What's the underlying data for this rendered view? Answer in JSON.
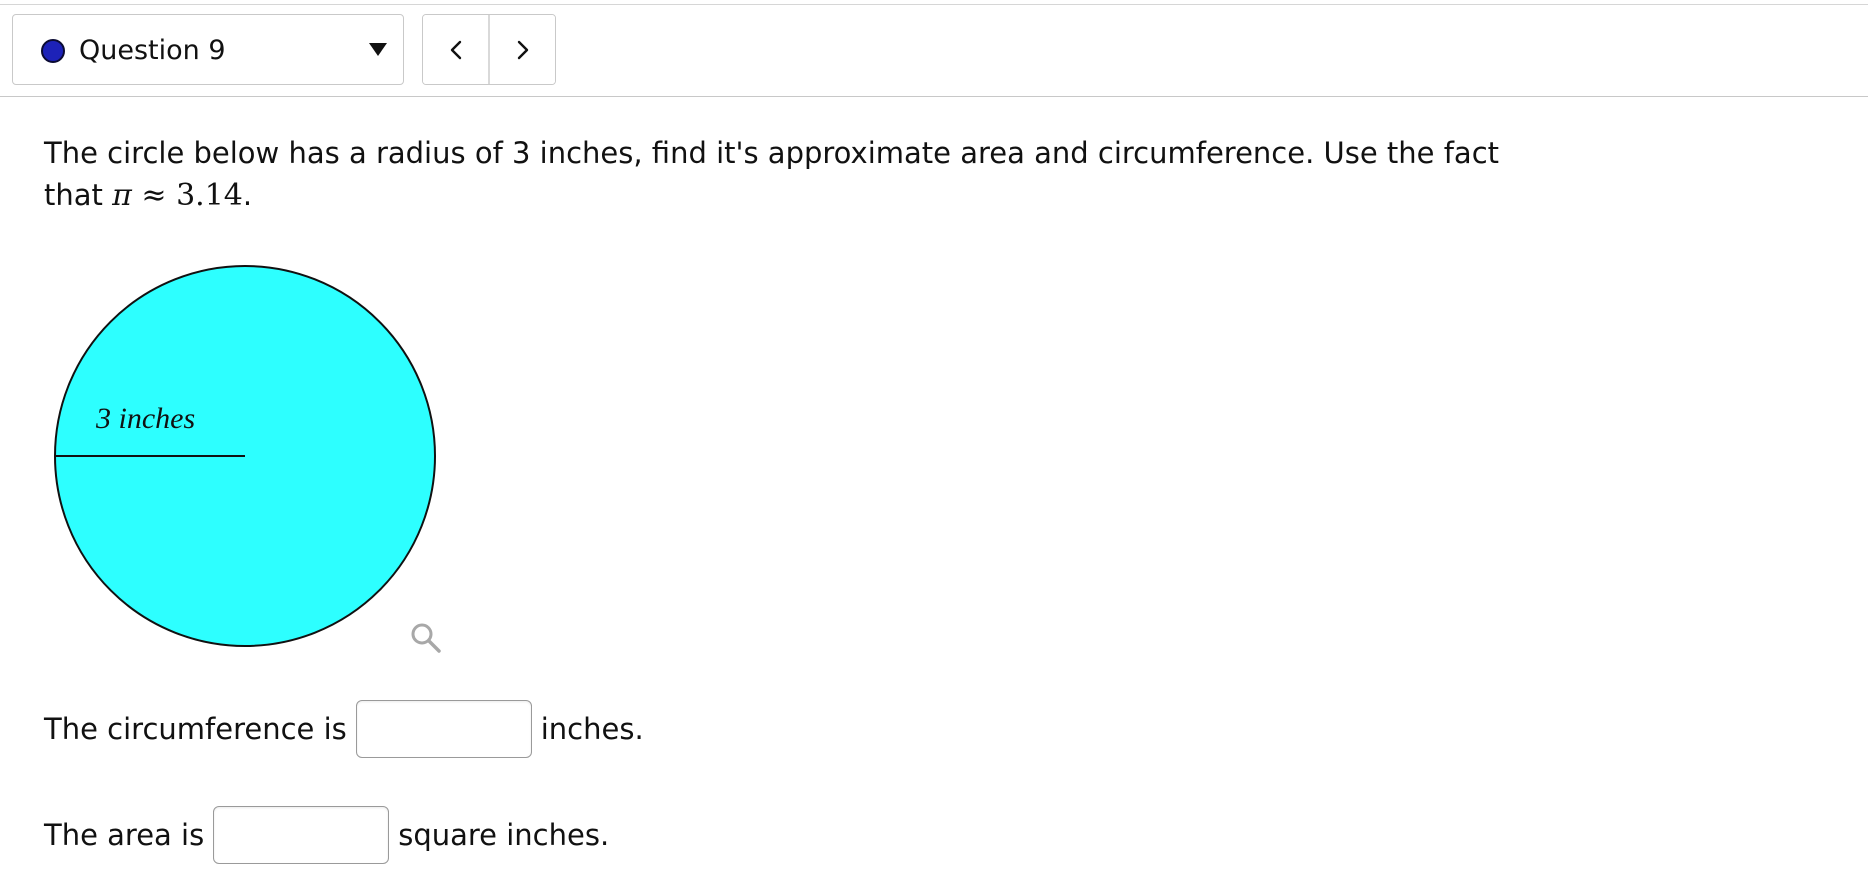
{
  "header": {
    "question_select": {
      "label": "Question 9",
      "status_color": "#1d22b8"
    },
    "nav": {
      "prev_icon": "chevron-left-icon",
      "next_icon": "chevron-right-icon"
    }
  },
  "problem": {
    "text_line1": "The circle below has a radius of 3 inches, find it's approximate area and circumference. Use the fact",
    "text_line2_prefix": "that ",
    "pi_symbol": "π",
    "approx_symbol": "≈",
    "pi_value": "3.14",
    "text_line2_suffix": "."
  },
  "figure": {
    "radius_label": "3 inches",
    "circle_fill": "#2dffff",
    "zoom_icon": "magnifier-icon"
  },
  "answers": {
    "circumference": {
      "prefix": "The circumference is",
      "value": "",
      "suffix": "inches."
    },
    "area": {
      "prefix": "The area is",
      "value": "",
      "suffix": "square inches."
    }
  }
}
